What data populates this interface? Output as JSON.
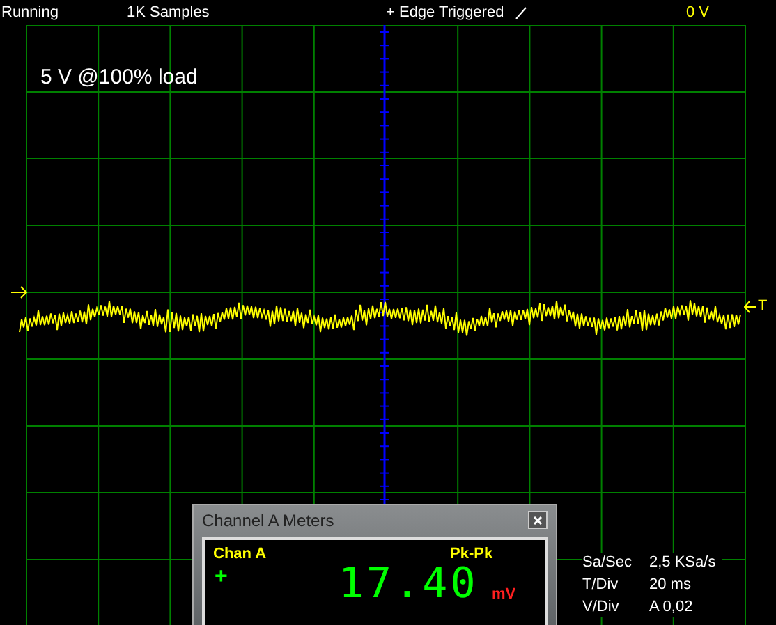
{
  "status_bar": {
    "state": "Running",
    "samples": "1K Samples",
    "trigger": "+ Edge Triggered",
    "trigger_level": "0 V"
  },
  "annotation": "5 V @100% load",
  "trigger_marker": "T",
  "meter_window": {
    "title": "Channel A Meters",
    "channel": "Chan A",
    "measure": "Pk-Pk",
    "polarity": "+",
    "reading": "17.40",
    "unit": "mV"
  },
  "readouts": [
    {
      "label": "Sa/Sec",
      "value": "2,5 KSa/s"
    },
    {
      "label": "T/Div",
      "value": "20 ms"
    },
    {
      "label": "V/Div",
      "value": "A 0,02"
    }
  ]
}
